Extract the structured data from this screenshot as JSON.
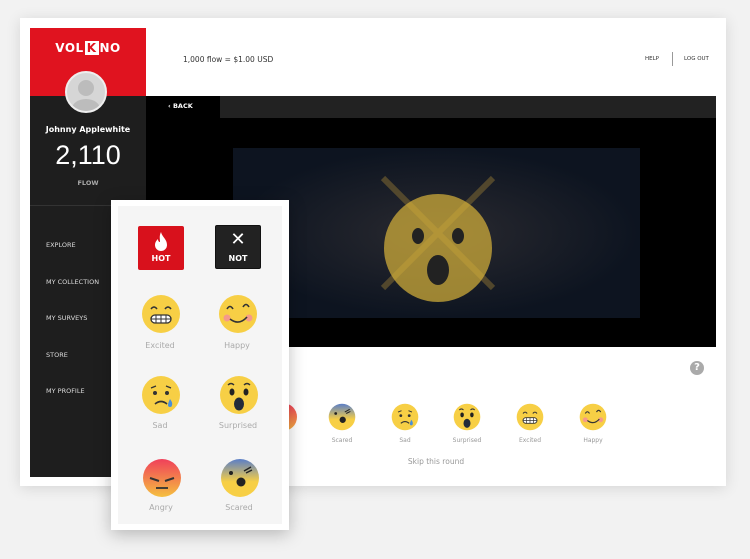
{
  "brand": {
    "logo": "VOLKNO",
    "logo_parts": [
      "VOL",
      "K",
      "NO"
    ],
    "color": "#e0131f"
  },
  "user": {
    "name": "Johnny Applewhite",
    "flow_balance": "2,110",
    "flow_label": "FLOW"
  },
  "sidebar": {
    "items": [
      {
        "label": "EXPLORE"
      },
      {
        "label": "MY COLLECTION"
      },
      {
        "label": "MY SURVEYS"
      },
      {
        "label": "STORE"
      },
      {
        "label": "MY PROFILE"
      }
    ]
  },
  "header": {
    "rate": "1,000 flow = $1.00 USD",
    "help": "HELP",
    "logout": "LOG OUT"
  },
  "video": {
    "back_label": "BACK"
  },
  "reactions": {
    "row": [
      {
        "label": "Scared",
        "icon": "scared"
      },
      {
        "label": "Sad",
        "icon": "sad"
      },
      {
        "label": "Surprised",
        "icon": "surprised"
      },
      {
        "label": "Excited",
        "icon": "excited"
      },
      {
        "label": "Happy",
        "icon": "happy"
      }
    ],
    "skip": "Skip this round",
    "help_icon": "question-icon"
  },
  "popup": {
    "hot": "HOT",
    "not": "NOT",
    "items": [
      {
        "label": "Excited",
        "icon": "excited"
      },
      {
        "label": "Happy",
        "icon": "happy"
      },
      {
        "label": "Sad",
        "icon": "sad"
      },
      {
        "label": "Surprised",
        "icon": "surprised"
      },
      {
        "label": "Angry",
        "icon": "angry"
      },
      {
        "label": "Scared",
        "icon": "scared"
      }
    ]
  }
}
